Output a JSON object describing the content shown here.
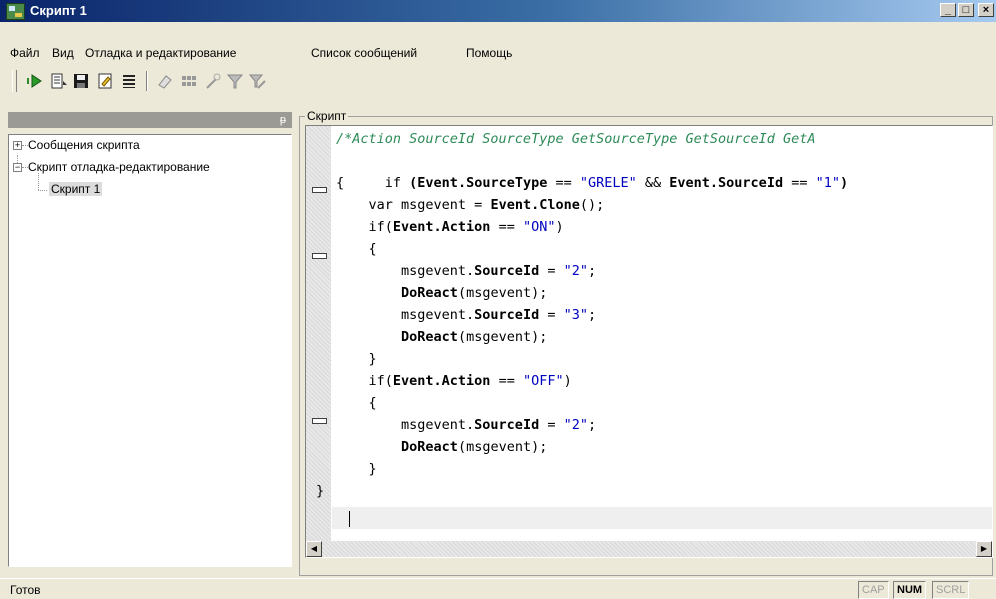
{
  "window": {
    "title": "Скрипт 1",
    "minimize": "_",
    "maximize": "□",
    "close": "×"
  },
  "menu": [
    "Файл",
    "Вид",
    "Отладка и редактирование",
    "Список сообщений",
    "Помощь"
  ],
  "toolbar": {
    "icons": [
      "run-icon",
      "step-icon",
      "save-icon",
      "new-script-icon",
      "list-icon",
      "eraser-icon",
      "grid-icon",
      "magic-icon",
      "filter-icon",
      "filter-edit-icon"
    ]
  },
  "left_panel": {
    "pin_glyph": "ᵽ",
    "tree": [
      {
        "label": "Сообщения скрипта",
        "expander": "+"
      },
      {
        "label": "Скрипт отладка-редактирование",
        "expander": "−"
      },
      {
        "label": "Скрипт 1",
        "selected": true
      }
    ]
  },
  "script_group": {
    "label": "Скрипт"
  },
  "code_lines": [
    "/*Action SourceId SourceType GetSourceType GetSourceId GetA",
    "if (Event.SourceType == \"GRELE\" && Event.SourceId == \"1\")",
    "{",
    "    var msgevent = Event.Clone();",
    "    if(Event.Action == \"ON\")",
    "    {",
    "        msgevent.SourceId = \"2\";",
    "        DoReact(msgevent);",
    "        msgevent.SourceId = \"3\";",
    "        DoReact(msgevent);",
    "    }",
    "    if(Event.Action == \"OFF\")",
    "    {",
    "        msgevent.SourceId = \"2\";",
    "        DoReact(msgevent);",
    "    }",
    "}"
  ],
  "status": {
    "text": "Готов",
    "cap": "CAP",
    "num": "NUM",
    "scrl": "SCRL"
  }
}
